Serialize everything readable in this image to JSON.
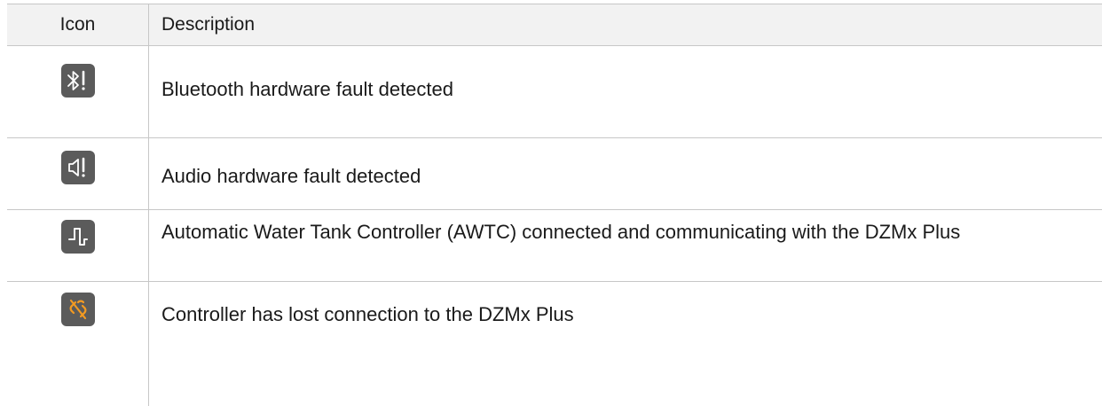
{
  "table": {
    "headers": {
      "icon": "Icon",
      "description": "Description"
    },
    "rows": [
      {
        "icon": "bluetooth-fault-icon",
        "description": "Bluetooth hardware fault detected"
      },
      {
        "icon": "audio-fault-icon",
        "description": "Audio hardware fault detected"
      },
      {
        "icon": "awtc-signal-icon",
        "description": "Automatic Water Tank Controller (AWTC) connected and communicating with the DZMx Plus"
      },
      {
        "icon": "connection-lost-icon",
        "description": "Controller has lost connection to the DZMx Plus"
      }
    ]
  },
  "colors": {
    "icon_background": "#5b5b5b",
    "icon_foreground": "#ffffff",
    "warning_accent": "#f39a21",
    "header_background": "#f2f2f2",
    "grid_lines": "#c7c7c7"
  }
}
